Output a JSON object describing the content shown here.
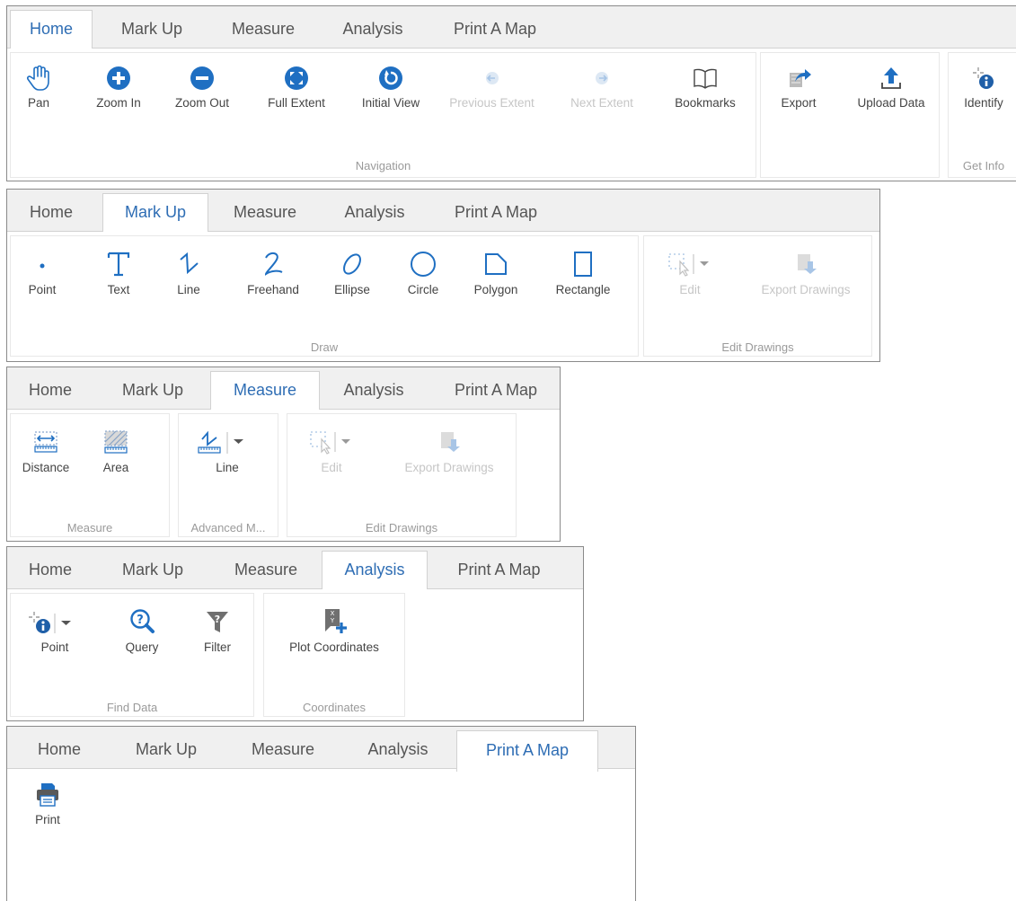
{
  "tabs": [
    "Home",
    "Mark Up",
    "Measure",
    "Analysis",
    "Print A Map"
  ],
  "home": {
    "nav": {
      "pan": "Pan",
      "zoom_in": "Zoom In",
      "zoom_out": "Zoom Out",
      "full_extent": "Full Extent",
      "initial_view": "Initial View",
      "previous_extent": "Previous Extent",
      "next_extent": "Next Extent",
      "bookmarks": "Bookmarks"
    },
    "nav_label": "Navigation",
    "export": "Export",
    "upload_data": "Upload Data",
    "identify": "Identify",
    "get_info_label": "Get Info"
  },
  "markup": {
    "draw": {
      "point": "Point",
      "text": "Text",
      "line": "Line",
      "freehand": "Freehand",
      "ellipse": "Ellipse",
      "circle": "Circle",
      "polygon": "Polygon",
      "rectangle": "Rectangle"
    },
    "draw_label": "Draw",
    "edit": "Edit",
    "export_drawings": "Export Drawings",
    "edit_drawings_label": "Edit Drawings"
  },
  "measure": {
    "distance": "Distance",
    "area": "Area",
    "measure_label": "Measure",
    "line": "Line",
    "advanced_label": "Advanced M...",
    "edit": "Edit",
    "export_drawings": "Export Drawings",
    "edit_drawings_label": "Edit Drawings"
  },
  "analysis": {
    "point": "Point",
    "query": "Query",
    "filter": "Filter",
    "find_data_label": "Find Data",
    "plot_coordinates": "Plot Coordinates",
    "coordinates_label": "Coordinates"
  },
  "print": {
    "print": "Print"
  },
  "colors": {
    "accent": "#2e6db4",
    "icon_blue": "#1f6fc2",
    "disabled": "#c6c6c6",
    "tab_bg": "#f0f0f0"
  }
}
